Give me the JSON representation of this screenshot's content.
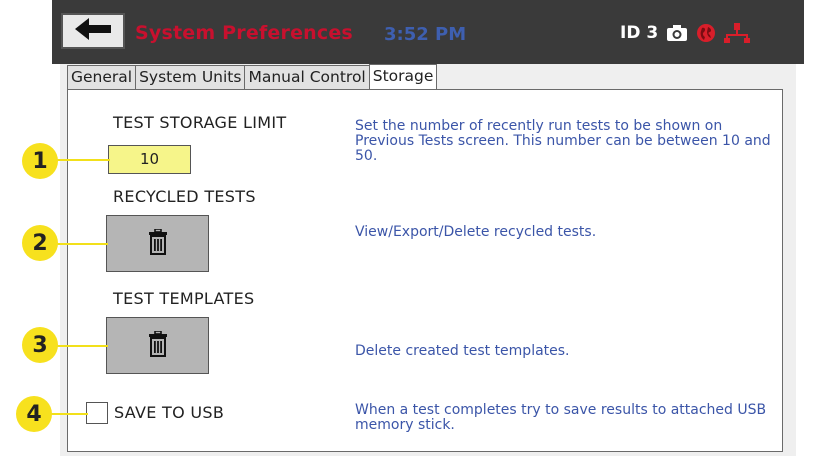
{
  "header": {
    "title": "System Preferences",
    "time": "3:52 PM",
    "id_label": "ID 3",
    "icons": [
      "back-arrow-icon",
      "camera-icon",
      "globe-icon",
      "network-icon"
    ]
  },
  "tabs": [
    {
      "label": "General",
      "active": false
    },
    {
      "label": "System Units",
      "active": false
    },
    {
      "label": "Manual Control",
      "active": false
    },
    {
      "label": "Storage",
      "active": true
    }
  ],
  "storage": {
    "limit_label": "TEST STORAGE LIMIT",
    "limit_value": "10",
    "limit_desc": "Set the number of recently run tests to be shown on Previous Tests screen. This number can be between 10 and 50.",
    "recycled_label": "RECYCLED TESTS",
    "recycled_desc": "View/Export/Delete recycled tests.",
    "templates_label": "TEST TEMPLATES",
    "templates_desc": "Delete created test templates.",
    "usb_label": "SAVE TO USB",
    "usb_checked": false,
    "usb_desc": "When a test completes try to save results to attached USB memory stick."
  },
  "callouts": [
    "1",
    "2",
    "3",
    "4"
  ],
  "colors": {
    "title": "#c8102e",
    "clock": "#3e5fb0",
    "description": "#3b55a8",
    "callout": "#f7e11e",
    "number_field": "#f6f58a"
  }
}
